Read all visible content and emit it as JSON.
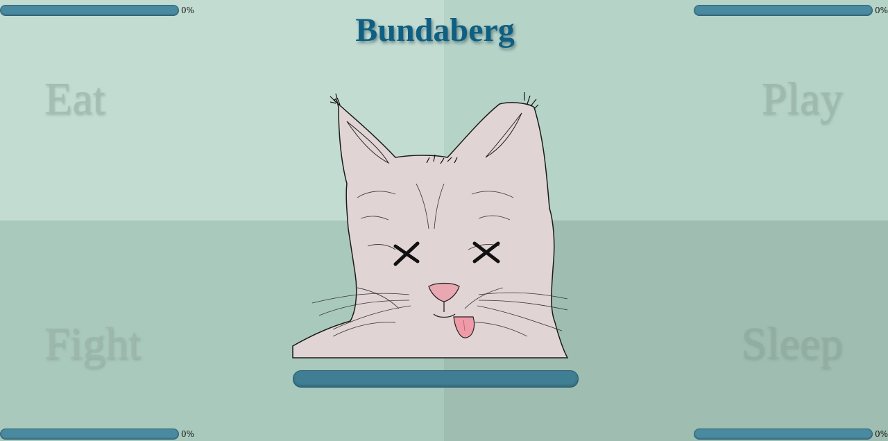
{
  "pet": {
    "name": "Bundaberg",
    "state": "dead"
  },
  "actions": {
    "eat": "Eat",
    "play": "Play",
    "fight": "Fight",
    "sleep": "Sleep"
  },
  "stats": {
    "top_left": {
      "percent": 0,
      "label": "0%"
    },
    "top_right": {
      "percent": 0,
      "label": "0%"
    },
    "bottom_left": {
      "percent": 0,
      "label": "0%"
    },
    "bottom_right": {
      "percent": 0,
      "label": "0%"
    }
  },
  "main_bar": {
    "percent": 0
  },
  "icons": {
    "pet": "cat-head-icon",
    "eyes": "x-eyes-icon"
  },
  "colors": {
    "bar": "#4a8aa0",
    "title": "#0f5f82",
    "cat_fur": "#e1d4d4",
    "tongue": "#ef9aa8"
  }
}
